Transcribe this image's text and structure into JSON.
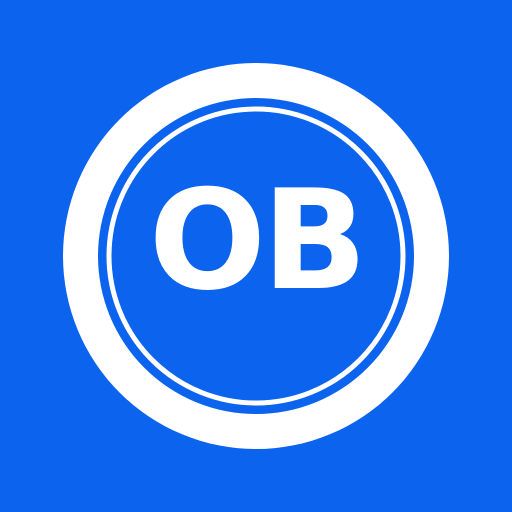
{
  "logo": {
    "text": "OB",
    "colors": {
      "background": "#0b63ee",
      "foreground": "#ffffff"
    },
    "icon": "ob-club-crest"
  }
}
